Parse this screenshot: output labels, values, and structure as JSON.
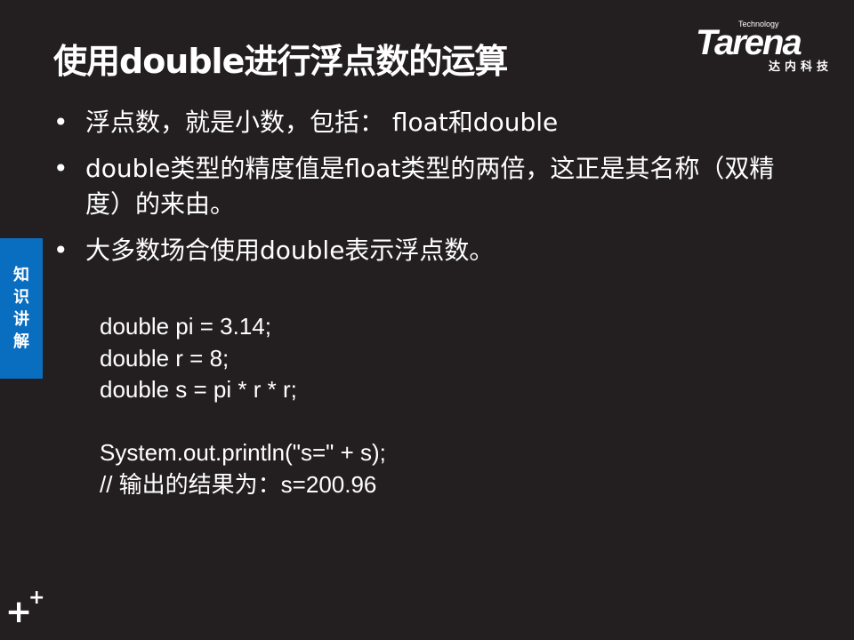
{
  "title": "使用double进行浮点数的运算",
  "logo": {
    "tech": "Technology",
    "brand": "Tarena",
    "cn": "达内科技"
  },
  "side_tab": [
    "知",
    "识",
    "讲",
    "解"
  ],
  "bullet_symbol": "•",
  "bullets": [
    "浮点数，就是小数，包括： float和double",
    "double类型的精度值是float类型的两倍，这正是其名称（双精度）的来由。",
    "大多数场合使用double表示浮点数。"
  ],
  "code": [
    "double pi = 3.14;",
    "double r = 8;",
    "double s = pi * r * r;",
    "",
    "System.out.println(\"s=\" + s);",
    "// 输出的结果为：s=200.96"
  ],
  "corner_icon": "plus-plus-icon"
}
